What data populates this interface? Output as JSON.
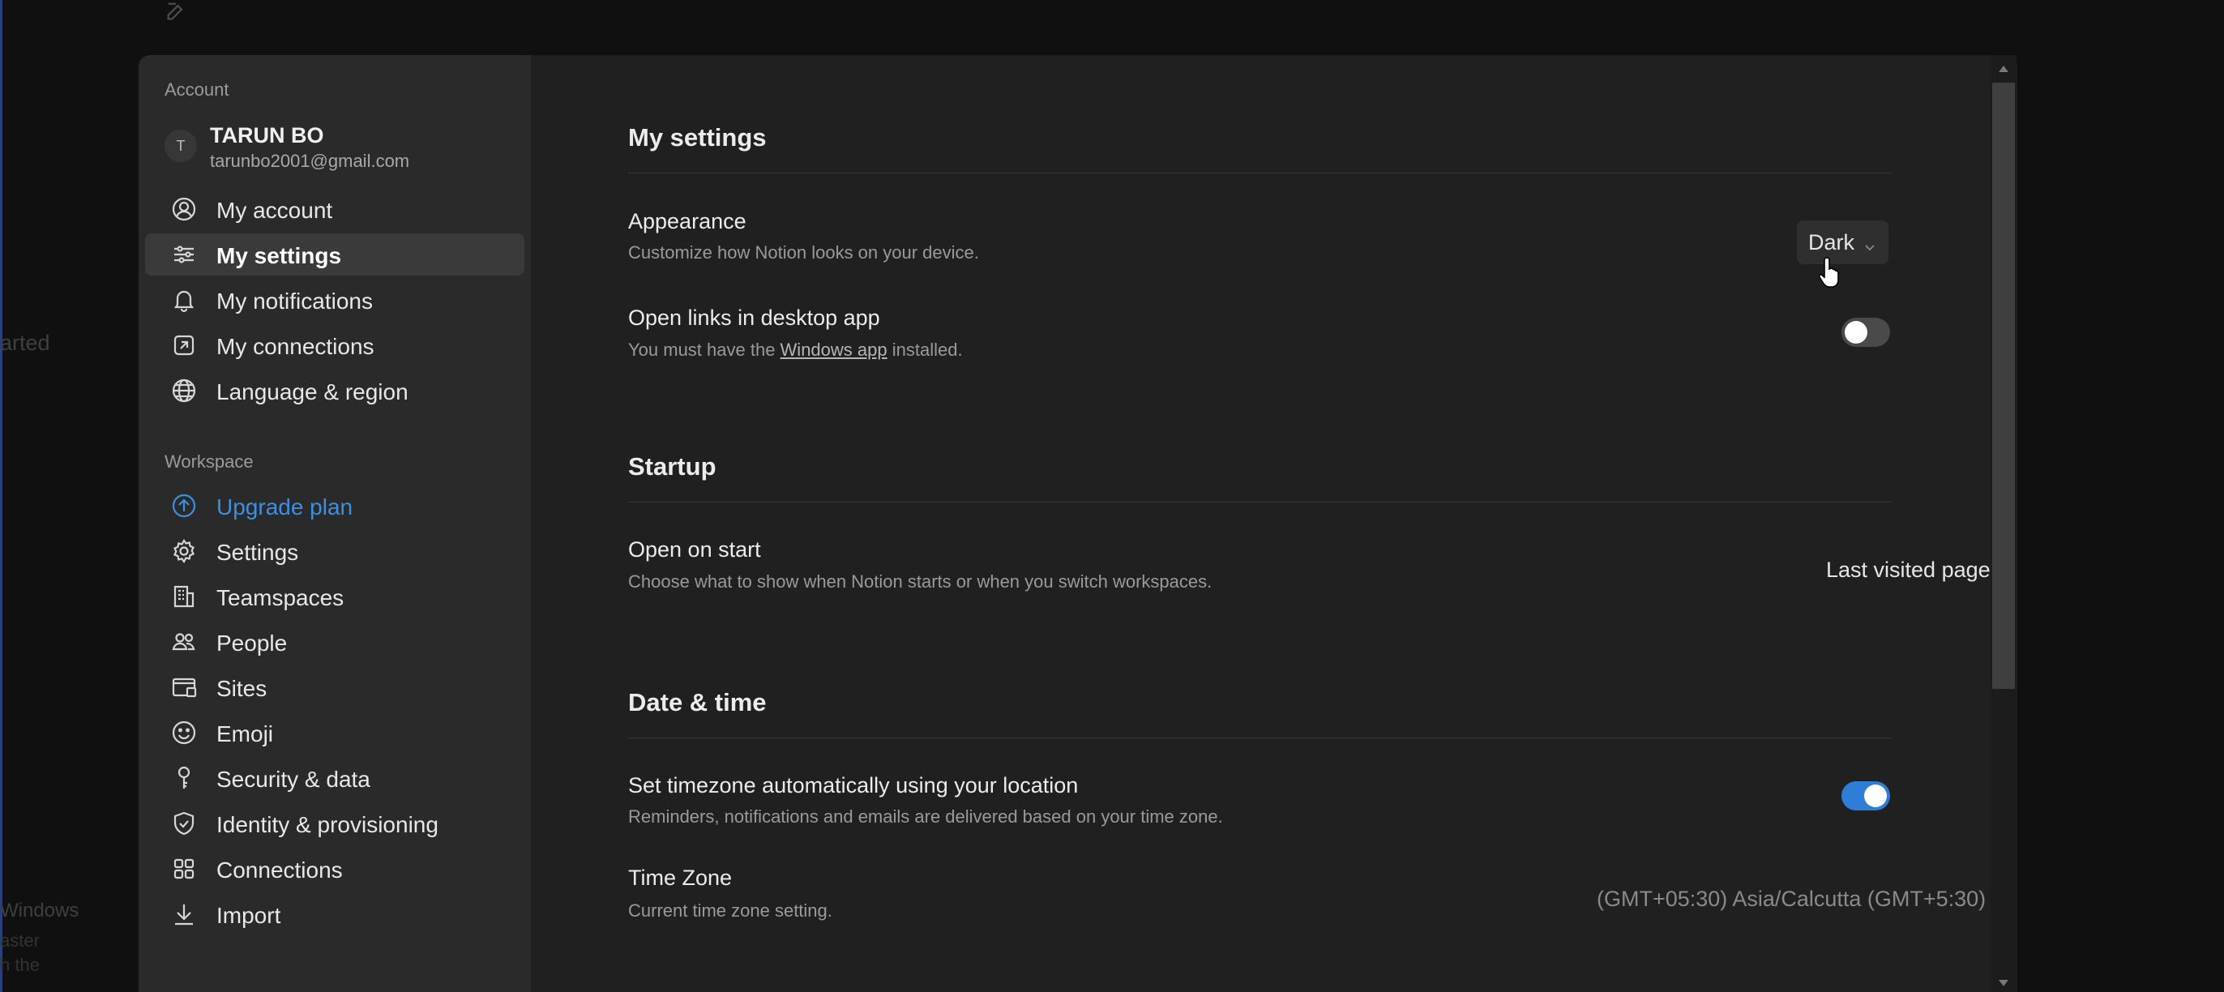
{
  "sidebar": {
    "account_heading": "Account",
    "user": {
      "avatar_letter": "T",
      "name": "TARUN BO",
      "email": "tarunbo2001@gmail.com"
    },
    "account_items": [
      {
        "label": "My account",
        "icon": "user-circle-icon"
      },
      {
        "label": "My settings",
        "icon": "sliders-icon",
        "active": true
      },
      {
        "label": "My notifications",
        "icon": "bell-icon"
      },
      {
        "label": "My connections",
        "icon": "external-link-icon"
      },
      {
        "label": "Language & region",
        "icon": "globe-icon"
      }
    ],
    "workspace_heading": "Workspace",
    "workspace_items": [
      {
        "label": "Upgrade plan",
        "icon": "arrow-up-circle-icon",
        "accent": "#3d8fe0"
      },
      {
        "label": "Settings",
        "icon": "gear-icon"
      },
      {
        "label": "Teamspaces",
        "icon": "building-icon"
      },
      {
        "label": "People",
        "icon": "people-icon"
      },
      {
        "label": "Sites",
        "icon": "browser-icon"
      },
      {
        "label": "Emoji",
        "icon": "smile-icon"
      },
      {
        "label": "Security & data",
        "icon": "key-icon"
      },
      {
        "label": "Identity & provisioning",
        "icon": "shield-icon"
      },
      {
        "label": "Connections",
        "icon": "grid-icon"
      },
      {
        "label": "Import",
        "icon": "download-icon"
      }
    ]
  },
  "main": {
    "my_settings": {
      "title": "My settings",
      "appearance": {
        "title": "Appearance",
        "desc": "Customize how Notion looks on your device.",
        "value": "Dark"
      },
      "open_links": {
        "title": "Open links in desktop app",
        "desc_prefix": "You must have the ",
        "desc_link": "Windows app",
        "desc_suffix": " installed.",
        "enabled": false
      }
    },
    "startup": {
      "title": "Startup",
      "open_on_start": {
        "title": "Open on start",
        "desc": "Choose what to show when Notion starts or when you switch workspaces.",
        "value": "Last visited page"
      }
    },
    "date_time": {
      "title": "Date & time",
      "auto_timezone": {
        "title": "Set timezone automatically using your location",
        "desc": "Reminders, notifications and emails are delivered based on your time zone.",
        "enabled": true
      },
      "time_zone": {
        "title": "Time Zone",
        "desc": "Current time zone setting.",
        "value": "(GMT+05:30) Asia/Calcutta (GMT+5:30)"
      }
    }
  },
  "background": {
    "started_fragment": "arted",
    "windows_fragment": "Windows",
    "faster_fragment": "aster",
    "with_fragment": "h the"
  },
  "colors": {
    "accent": "#2e7dd6",
    "modal_bg": "#202020",
    "sidebar_bg": "#2a2a2a"
  }
}
